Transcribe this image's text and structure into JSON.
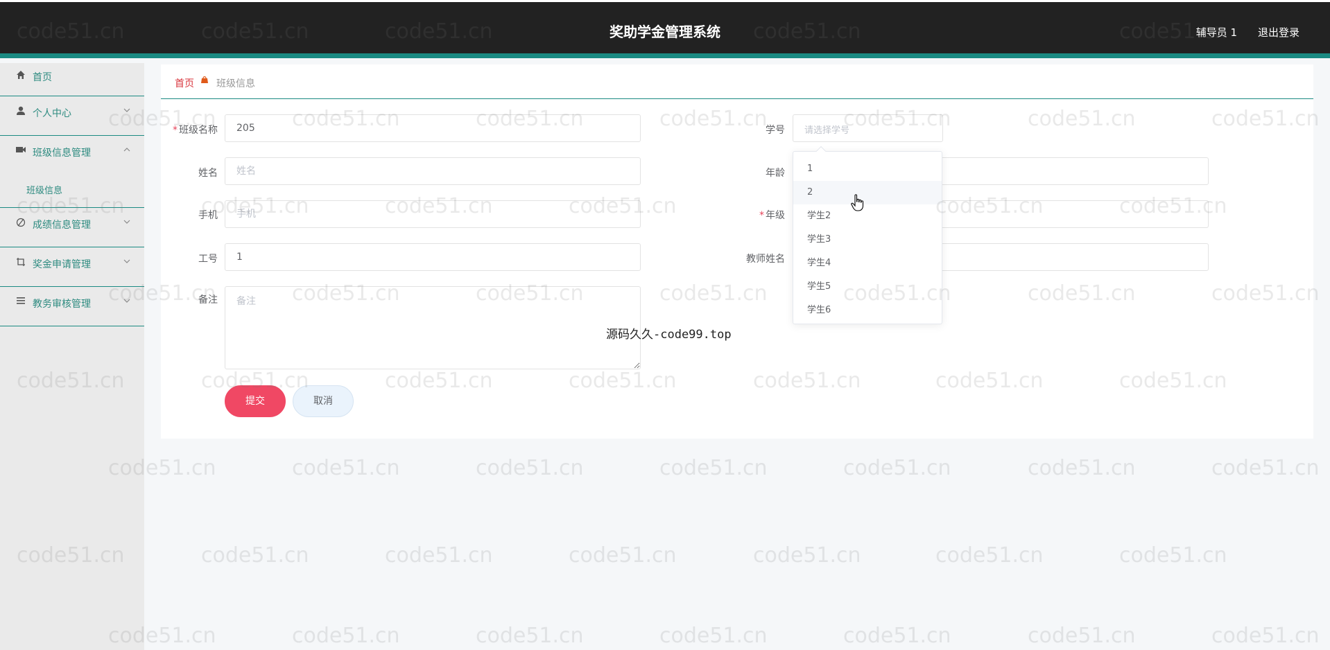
{
  "header": {
    "title": "奖助学金管理系统",
    "user_label": "辅导员 1",
    "logout_label": "退出登录"
  },
  "sidebar": {
    "items": [
      {
        "label": "首页",
        "icon": "home-icon"
      },
      {
        "label": "个人中心",
        "icon": "user-icon",
        "expanded": false
      },
      {
        "label": "班级信息管理",
        "icon": "video-camera-icon",
        "expanded": true
      },
      {
        "label": "班级信息",
        "submenu": true
      },
      {
        "label": "成绩信息管理",
        "icon": "edit-icon",
        "expanded": false
      },
      {
        "label": "奖金申请管理",
        "icon": "crop-icon",
        "expanded": false
      },
      {
        "label": "教务审核管理",
        "icon": "list-icon",
        "expanded": false
      }
    ]
  },
  "breadcrumb": {
    "home": "首页",
    "current": "班级信息"
  },
  "form": {
    "class_name": {
      "label": "班级名称",
      "value": "205",
      "required": true
    },
    "student_no": {
      "label": "学号",
      "placeholder": "请选择学号"
    },
    "name": {
      "label": "姓名",
      "placeholder": "姓名"
    },
    "age": {
      "label": "年龄",
      "value": ""
    },
    "phone": {
      "label": "手机",
      "placeholder": "手机"
    },
    "grade": {
      "label": "年级",
      "value": "",
      "required": true
    },
    "work_no": {
      "label": "工号",
      "value": "1"
    },
    "teacher_name": {
      "label": "教师姓名",
      "value": ""
    },
    "remark": {
      "label": "备注",
      "placeholder": "备注"
    },
    "submit_label": "提交",
    "cancel_label": "取消"
  },
  "dropdown": {
    "options": [
      "1",
      "2",
      "学生2",
      "学生3",
      "学生4",
      "学生5",
      "学生6"
    ],
    "hovered_index": 1
  },
  "watermark": {
    "text": "code51.cn",
    "overlay_text": "源码久久-code99.top"
  },
  "colors": {
    "header_bg": "#222222",
    "accent": "#1a8a82",
    "submit": "#f04864",
    "breadcrumb_home": "#d9363e"
  }
}
